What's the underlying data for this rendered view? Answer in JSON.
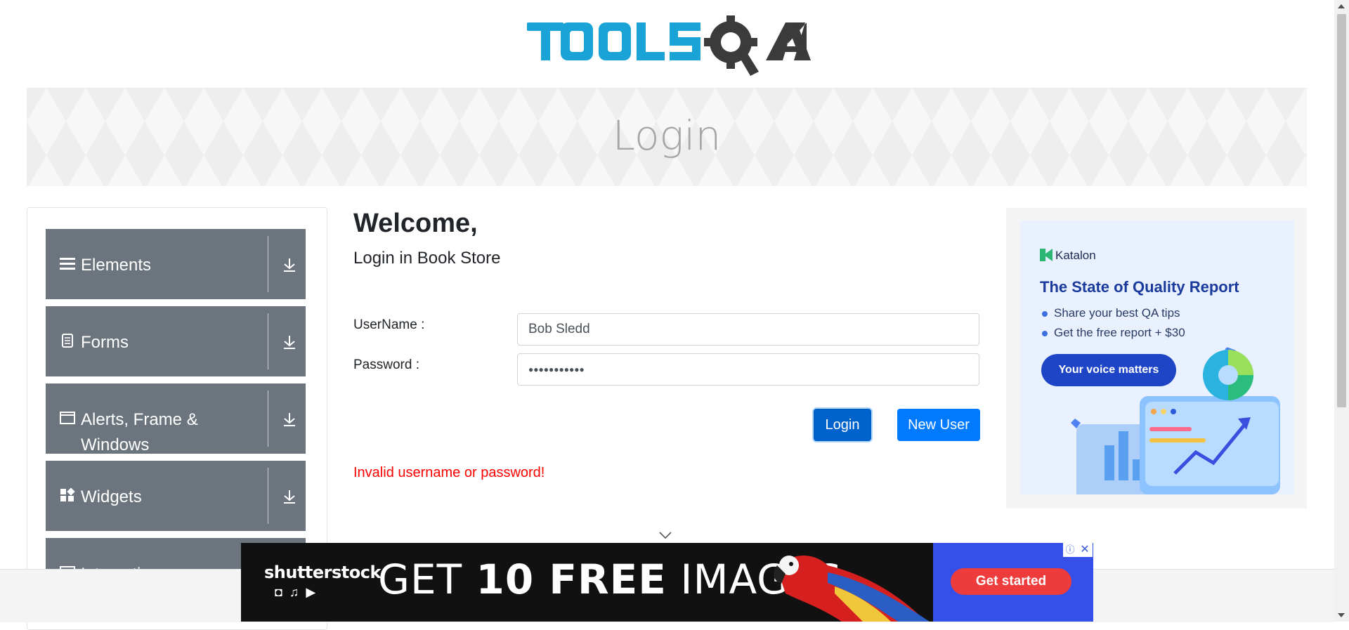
{
  "header": {
    "logo_text": "TOOLSQA"
  },
  "banner": {
    "title": "Login"
  },
  "sidebar": {
    "groups": [
      {
        "label": "Elements",
        "icon": "menu-icon"
      },
      {
        "label": "Forms",
        "icon": "document-icon"
      },
      {
        "label": "Alerts, Frame & Windows",
        "icon": "window-icon"
      },
      {
        "label": "Widgets",
        "icon": "widgets-icon"
      },
      {
        "label": "Interactions",
        "icon": "interactions-icon"
      }
    ]
  },
  "main": {
    "welcome": "Welcome,",
    "subtitle": "Login in Book Store",
    "username_label": "UserName :",
    "username_value": "Bob Sledd",
    "password_label": "Password :",
    "password_value": "●●●●●●●●●●●",
    "login_button": "Login",
    "new_user_button": "New User",
    "error_message": "Invalid username or password!"
  },
  "ad_right": {
    "brand": "Katalon",
    "title": "The State of Quality Report",
    "bullets": [
      "Share your best QA tips",
      "Get the free report + $30"
    ],
    "cta": "Your voice matters"
  },
  "ad_bottom": {
    "brand": "shutterstock",
    "headline_prefix": "GET",
    "headline_bold": "10 FREE",
    "headline_suffix": "IMAGES",
    "cta": "Get started",
    "close": "✕",
    "info": "ⓘ"
  },
  "colors": {
    "sidebar_group": "#6c757d",
    "primary": "#007bff",
    "error": "#ff0000",
    "logo_blue": "#1aa3d6"
  }
}
